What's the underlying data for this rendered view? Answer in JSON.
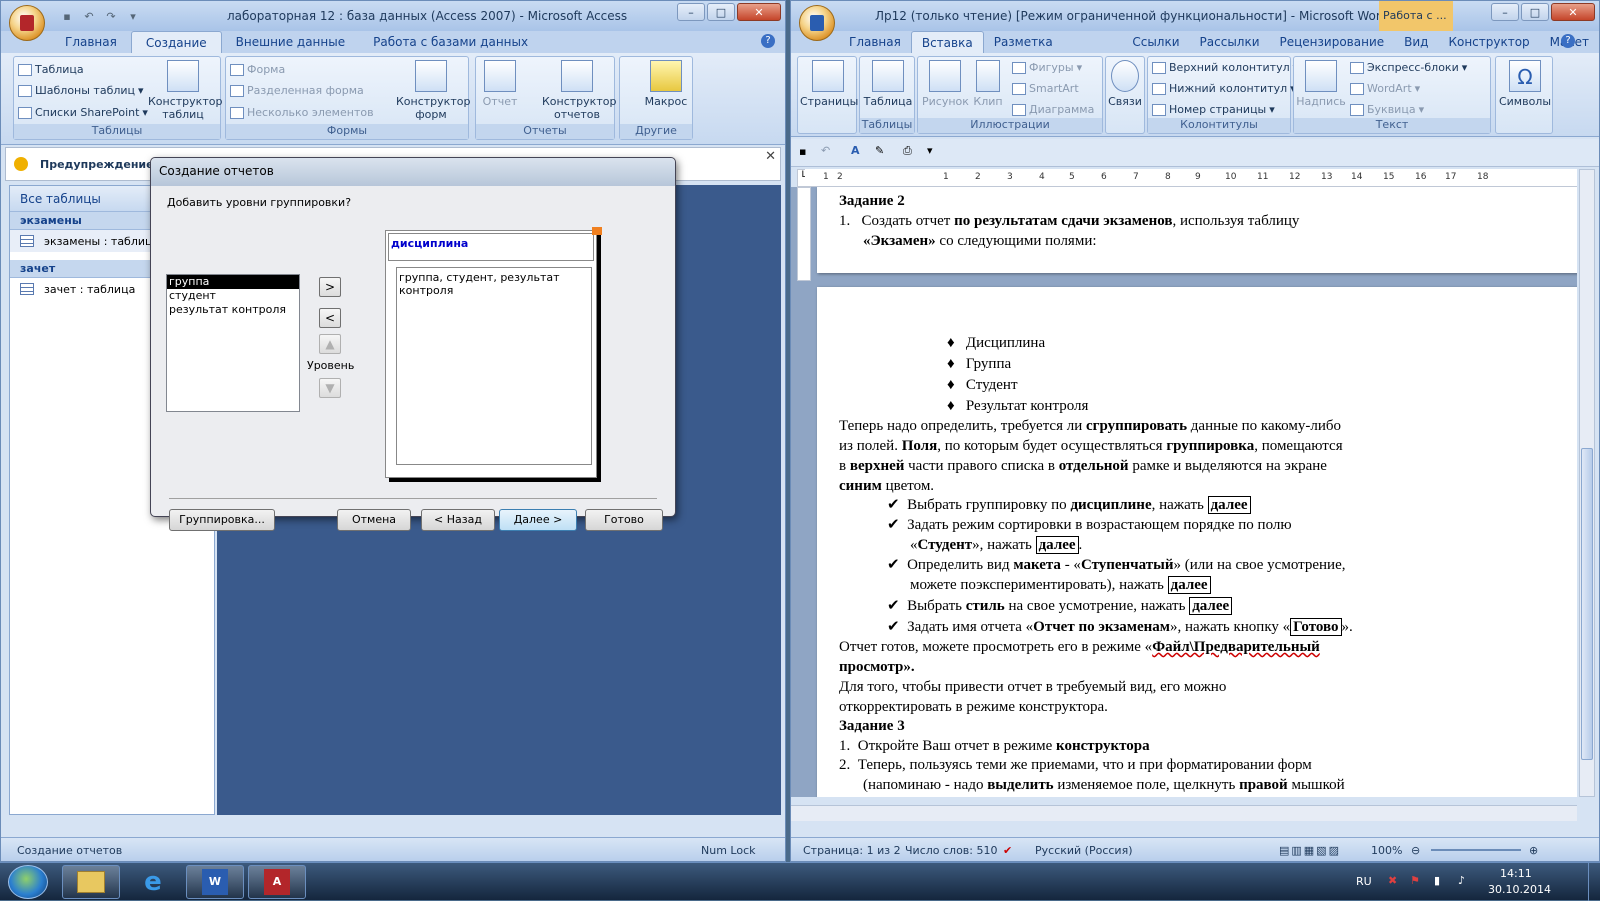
{
  "access": {
    "title": "лабораторная 12 : база данных (Access 2007)  -  Microsoft Access",
    "tabs": [
      "Главная",
      "Создание",
      "Внешние данные",
      "Работа с базами данных"
    ],
    "active_tab": "Создание",
    "ribbon": {
      "tables": {
        "table": "Таблица",
        "templates": "Шаблоны таблиц",
        "sharepoint": "Списки SharePoint",
        "designer": "Конструктор таблиц",
        "label": "Таблицы"
      },
      "forms": {
        "form": "Форма",
        "split": "Разделенная форма",
        "multi": "Несколько элементов",
        "designer": "Конструктор форм",
        "label": "Формы"
      },
      "reports": {
        "report": "Отчет",
        "designer": "Конструктор отчетов",
        "label": "Отчеты"
      },
      "other": {
        "macro": "Макрос",
        "label": "Другие"
      }
    },
    "message_bar": "Предупреждение си",
    "nav": {
      "header": "Все таблицы",
      "groups": [
        {
          "name": "экзамены",
          "items": [
            "экзамены : таблица"
          ]
        },
        {
          "name": "зачет",
          "items": [
            "зачет : таблица"
          ]
        }
      ]
    },
    "status": {
      "left": "Создание отчетов",
      "right": "Num Lock"
    }
  },
  "dialog": {
    "title": "Создание отчетов",
    "prompt": "Добавить уровни группировки?",
    "fields": [
      "группа",
      "студент",
      "результат контроля"
    ],
    "selected_field": "группа",
    "level_label": "Уровень",
    "preview_group": "дисциплина",
    "preview_detail": "группа, студент, результат контроля",
    "buttons": {
      "grouping": "Группировка...",
      "cancel": "Отмена",
      "back": "< Назад",
      "next": "Далее >",
      "finish": "Готово"
    },
    "arrows": {
      "add": ">",
      "remove": "<"
    }
  },
  "word": {
    "title": "Лр12 (только чтение) [Режим ограниченной функциональности]  -  Microsoft Word",
    "context_title": "Работа с ...",
    "tabs": [
      "Главная",
      "Вставка",
      "Разметка страницы",
      "Ссылки",
      "Рассылки",
      "Рецензирование",
      "Вид",
      "Конструктор",
      "Макет"
    ],
    "active_tab": "Вставка",
    "ribbon": {
      "pages": "Страницы",
      "table": "Таблица",
      "tables_label": "Таблицы",
      "picture": "Рисунок",
      "clip": "Клип",
      "shapes": "Фигуры",
      "smartart": "SmartArt",
      "chart": "Диаграмма",
      "illustrations_label": "Иллюстрации",
      "links": "Связи",
      "header": "Верхний колонтитул",
      "footer": "Нижний колонтитул",
      "page_number": "Номер страницы",
      "hf_label": "Колонтитулы",
      "textbox": "Надпись",
      "quickparts": "Экспресс-блоки",
      "wordart": "WordArt",
      "dropcap": "Буквица",
      "text_label": "Текст",
      "symbols": "Символы"
    },
    "ruler": [
      "1",
      "2",
      "1",
      "2",
      "3",
      "4",
      "5",
      "6",
      "7",
      "8",
      "9",
      "10",
      "11",
      "12",
      "13",
      "14",
      "15",
      "16",
      "17",
      "18"
    ],
    "page1": {
      "heading": "Задание  2",
      "line1_num": "1.",
      "line1": [
        "Создать   отчет   ",
        "по  результатам  сдачи  экзаменов",
        ",  используя  таблицу"
      ],
      "line2": [
        "«Экзамен»",
        " со следующими полями:"
      ]
    },
    "bullets": [
      "Дисциплина",
      "Группа",
      "Студент",
      "Результат  контроля"
    ],
    "para1": {
      "l1": [
        "Теперь  надо  определить,  требуется  ли  ",
        "сгруппировать",
        "  данные  по  какому-либо"
      ],
      "l2": [
        "из  полей. ",
        "Поля",
        ",  по  которым  будет  осуществляться  ",
        "группировка",
        ",  помещаются"
      ],
      "l3": [
        "в  ",
        "верхней",
        "  части  правого  списка  в  ",
        "отдельной",
        "  рамке  и  выделяются  на  экране"
      ],
      "l4": [
        "синим",
        "  цветом."
      ]
    },
    "checks": {
      "c1": [
        "Выбрать  группировку  по  ",
        "дисциплине",
        ",  нажать  ",
        "далее"
      ],
      "c2a": [
        "Задать   режим   сортировки   в   возрастающем   порядке   по   полю"
      ],
      "c2b": [
        "«",
        "Студент",
        "», нажать  ",
        "далее",
        "."
      ],
      "c3a": [
        "Определить  вид  ",
        "макета",
        "  - «",
        "Ступенчатый",
        "» (или  на  свое  усмотрение,"
      ],
      "c3b": [
        "можете  поэкспериментировать),  нажать  ",
        "далее"
      ],
      "c4": [
        "Выбрать  ",
        "стиль",
        "  на  свое  усмотрение,  нажать  ",
        "далее"
      ],
      "c5": [
        "Задать  имя  отчета  «",
        "Отчет  по  экзаменам",
        "»,  нажать  кнопку  «",
        "Готово",
        "»."
      ]
    },
    "para2": {
      "l1": [
        "Отчет   готов,   можете   просмотреть   его   в   режиме   «",
        "Файл\\Предварительный"
      ],
      "l2": [
        "просмотр»."
      ]
    },
    "para3": {
      "l1": "Для     того,     чтобы     привести     отчет     в     требуемый     вид,     его     можно",
      "l2": "откорректировать  в  режиме  конструктора."
    },
    "task3": {
      "heading": "Задание 3",
      "i1_num": "1.",
      "i1": [
        "Откройте  Ваш  отчет  в  режиме  ",
        "конструктора"
      ],
      "i2_num": "2.",
      "i2a": "Теперь,   пользуясь   теми   же   приемами,   что   и   при   форматировании   форм",
      "i2b": [
        "(напоминаю  -  надо  ",
        "выделить",
        "  изменяемое  поле,  щелкнуть  ",
        "правой",
        "  мышкой"
      ]
    },
    "status": {
      "page": "Страница: 1 из 2",
      "words": "Число слов: 510",
      "lang": "Русский (Россия)",
      "zoom": "100%"
    }
  },
  "taskbar": {
    "lang": "RU",
    "time": "14:11",
    "date": "30.10.2014"
  }
}
